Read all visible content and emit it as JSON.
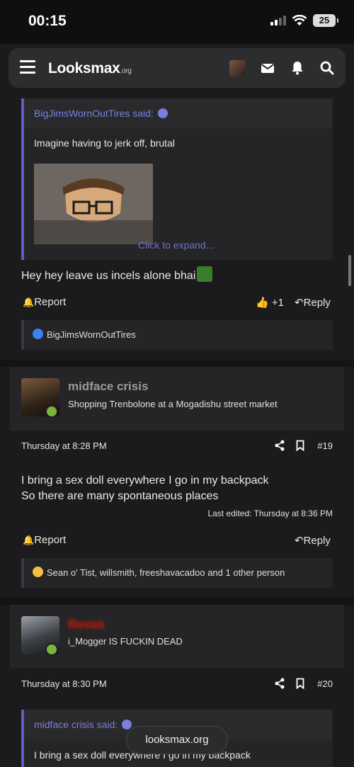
{
  "status_bar": {
    "time": "00:15",
    "battery": "25"
  },
  "nav": {
    "logo_main": "Looksmax",
    "logo_suffix": ".org"
  },
  "post1": {
    "quote_author": "BigJimsWornOutTires said:",
    "quote_text": "Imagine having to jerk off, brutal",
    "expand_label": "Click to expand...",
    "body": "Hey hey leave us incels alone bhai",
    "report_label": "Report",
    "like_count": "+1",
    "reply_label": "Reply",
    "reactions": "BigJimsWornOutTires"
  },
  "post19": {
    "username": "midface crisis",
    "user_title": "Shopping Trenbolone at a Mogadishu street market",
    "date": "Thursday at 8:28 PM",
    "number": "#19",
    "body_line1": "I bring a sex doll everywhere I go in my backpack",
    "body_line2": "So there are many spontaneous places",
    "edited": "Last edited: Thursday at 8:36 PM",
    "report_label": "Report",
    "reply_label": "Reply",
    "reactions": "Sean o' Tist, willsmith, freeshavacadoo and 1 other person"
  },
  "post20": {
    "username": "Revan",
    "user_title": "i_Mogger IS FUCKIN DEAD",
    "date": "Thursday at 8:30 PM",
    "number": "#20",
    "quote_author": "midface crisis said:",
    "quote_text": "I bring a sex doll everywhere I go in my backpack"
  },
  "url_pill": "looksmax.org",
  "colors": {
    "link": "#7b7ee0",
    "online": "#7db53a",
    "revan": "#8b1a10"
  }
}
